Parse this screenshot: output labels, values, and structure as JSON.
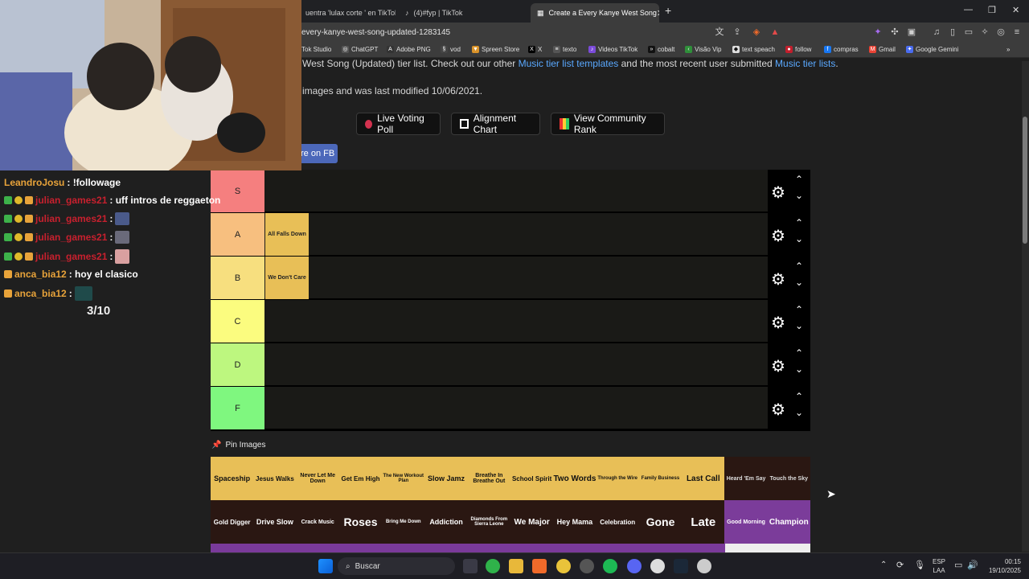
{
  "browser": {
    "tabs": [
      {
        "title": "uentra 'lulax corte ' en TikTok |"
      },
      {
        "title": "(4)#fyp | TikTok"
      },
      {
        "title": "Create a Every Kanye West Song",
        "active": true
      }
    ],
    "new_tab": "+",
    "url": "every-kanye-west-song-updated-1283145",
    "bookmarks": [
      "Tok Studio",
      "ChatGPT",
      "Adobe PNG",
      "vod",
      "Spreen Store",
      "X",
      "texto",
      "Videos TikTok",
      "cobalt",
      "Visão Vip",
      "text speach",
      "follow",
      "compras",
      "Gmail",
      "Google Gemini"
    ]
  },
  "page": {
    "intro_start": "West Song (Updated) tier list. Check out our other ",
    "link1": "Music tier list templates",
    "intro_mid": " and the most recent user submitted ",
    "link2": "Music tier lists",
    "intro_end": ".",
    "info_line": "images and was last modified 10/06/2021.",
    "buttons": {
      "poll": "Live Voting Poll",
      "align": "Alignment Chart",
      "rank": "View Community Rank"
    },
    "fb_share": "re on FB",
    "pin_images": "Pin Images"
  },
  "tiers": [
    {
      "label": "S",
      "color": "#f57f7f",
      "items": []
    },
    {
      "label": "A",
      "color": "#f7bf7f",
      "items": [
        "All Falls Down"
      ]
    },
    {
      "label": "B",
      "color": "#f7df7f",
      "items": [
        "We Don't Care"
      ]
    },
    {
      "label": "C",
      "color": "#fbfc7f",
      "items": []
    },
    {
      "label": "D",
      "color": "#bdf77f",
      "items": []
    },
    {
      "label": "F",
      "color": "#7ff77f",
      "items": []
    }
  ],
  "pool_row1": [
    "Spaceship",
    "Jesus Walks",
    "Never Let Me Down",
    "Get Em High",
    "The New Workout Plan",
    "Slow Jamz",
    "Breathe In Breathe Out",
    "School Spirit",
    "Two Words",
    "Through the Wire",
    "Family Business",
    "Last Call",
    "Heard 'Em Say",
    "Touch the Sky"
  ],
  "pool_row2": [
    "Gold Digger",
    "Drive Slow",
    "Crack Music",
    "Roses",
    "Bring Me Down",
    "Addiction",
    "Diamonds From Sierra Leone",
    "We Major",
    "Hey Mama",
    "Celebration",
    "Gone",
    "Late",
    "Good Morning",
    "Champion"
  ],
  "chat": [
    {
      "user": "LeandroJosu",
      "text": ": !followage",
      "color": "#e8a33a"
    },
    {
      "user": "julian_games21",
      "text": ": uff intros de reggaeton",
      "color": "#c8202e"
    },
    {
      "user": "julian_games21",
      "text": ":",
      "color": "#c8202e"
    },
    {
      "user": "julian_games21",
      "text": ":",
      "color": "#c8202e"
    },
    {
      "user": "julian_games21",
      "text": ":",
      "color": "#c8202e"
    },
    {
      "user": "anca_bia12",
      "text": ": hoy el clasico",
      "color": "#e8a33a"
    },
    {
      "user": "anca_bia12",
      "text": ":",
      "color": "#e8a33a"
    }
  ],
  "score": "3/10",
  "taskbar": {
    "search": "Buscar",
    "lang1": "ESP",
    "lang2": "LAA",
    "time": "00:15",
    "date": "19/10/2025"
  }
}
